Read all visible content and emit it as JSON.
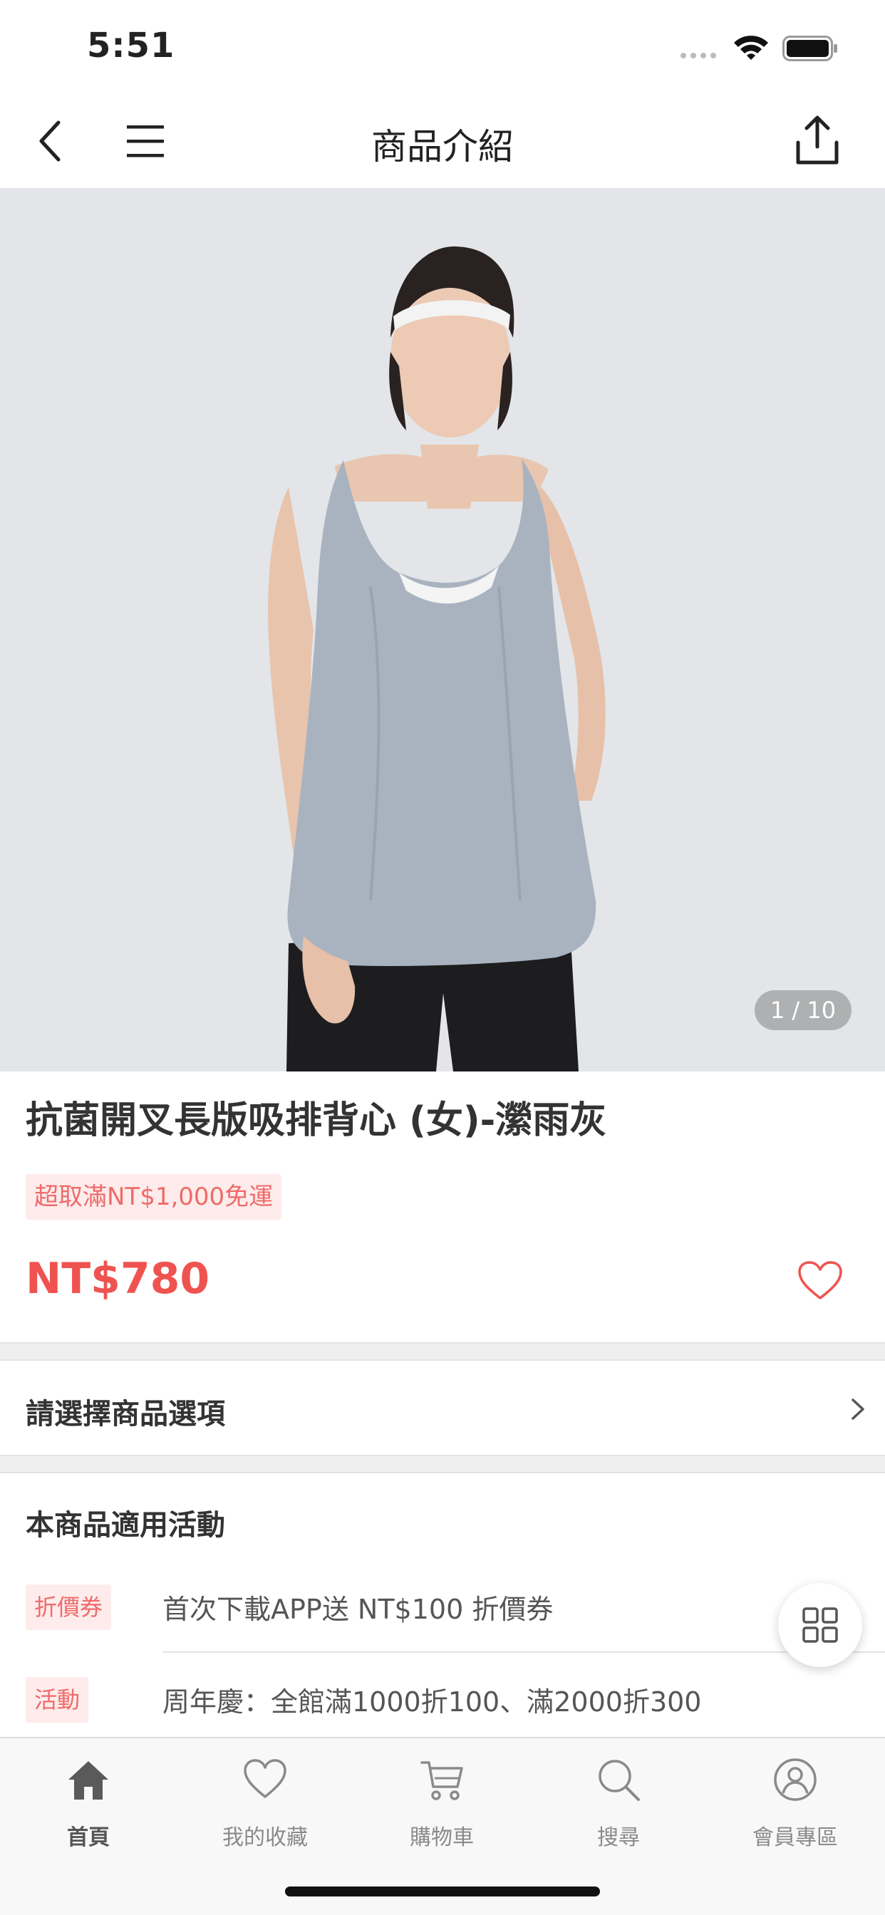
{
  "status_bar": {
    "time": "5:51"
  },
  "header": {
    "title": "商品介紹",
    "back_icon": "chevron-left-icon",
    "menu_icon": "hamburger-menu-icon",
    "share_icon": "share-icon"
  },
  "product": {
    "image_pager": "1 / 10",
    "name": "抗菌開叉長版吸排背心 (女)-瀠雨灰",
    "shipping_tag": "超取滿NT$1,000免運",
    "price": "NT$780",
    "favorite_icon": "heart-outline-icon"
  },
  "options": {
    "label": "請選擇商品選項"
  },
  "promotions": {
    "title": "本商品適用活動",
    "items": [
      {
        "tag": "折價券",
        "text": "首次下載APP送 NT$100 折價券"
      },
      {
        "tag": "活動",
        "text": "周年慶：全館滿1000折100、滿2000折300"
      }
    ]
  },
  "fab": {
    "icon": "grid-icon"
  },
  "tabbar": {
    "tabs": [
      {
        "label": "首頁",
        "icon": "home-icon",
        "active": true
      },
      {
        "label": "我的收藏",
        "icon": "heart-icon",
        "active": false
      },
      {
        "label": "購物車",
        "icon": "cart-icon",
        "active": false
      },
      {
        "label": "搜尋",
        "icon": "search-icon",
        "active": false
      },
      {
        "label": "會員專區",
        "icon": "user-icon",
        "active": false
      }
    ]
  },
  "colors": {
    "accent": "#ef5350",
    "tag_bg": "#fdeceb",
    "tag_text": "#f06a6a"
  }
}
